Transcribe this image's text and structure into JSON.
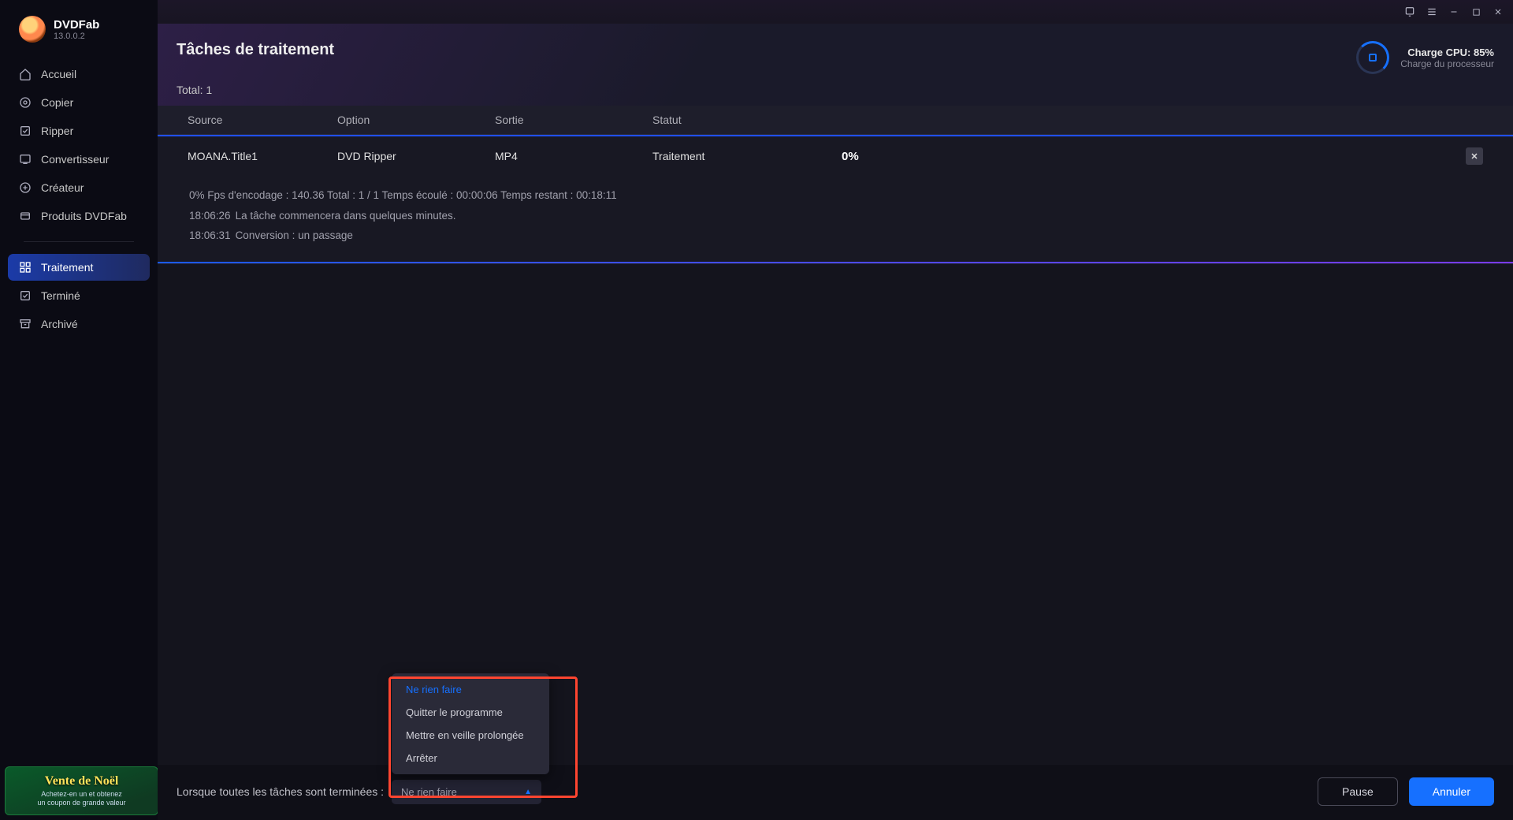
{
  "brand": {
    "name": "DVDFab",
    "version": "13.0.0.2"
  },
  "sidebar": {
    "items": [
      {
        "label": "Accueil"
      },
      {
        "label": "Copier"
      },
      {
        "label": "Ripper"
      },
      {
        "label": "Convertisseur"
      },
      {
        "label": "Créateur"
      },
      {
        "label": "Produits DVDFab"
      }
    ],
    "items2": [
      {
        "label": "Traitement"
      },
      {
        "label": "Terminé"
      },
      {
        "label": "Archivé"
      }
    ]
  },
  "promo": {
    "title": "Vente de Noël",
    "line1": "Achetez-en un et obtenez",
    "line2": "un coupon de grande valeur"
  },
  "page": {
    "title": "Tâches de traitement",
    "total_label": "Total: 1",
    "cpu_label": "Charge CPU: 85%",
    "cpu_sub": "Charge du processeur"
  },
  "columns": {
    "source": "Source",
    "option": "Option",
    "output": "Sortie",
    "status": "Statut"
  },
  "task": {
    "source": "MOANA.Title1",
    "option": "DVD Ripper",
    "output": "MP4",
    "status": "Traitement",
    "percent": "0%",
    "stats": "0%  Fps d'encodage : 140.36   Total : 1 / 1   Temps écoulé : 00:00:06   Temps restant : 00:18:11",
    "log1_time": "18:06:26",
    "log1_msg": "La tâche commencera dans quelques minutes.",
    "log2_time": "18:06:31",
    "log2_msg": "Conversion : un passage"
  },
  "footer": {
    "label": "Lorsque toutes les tâches sont terminées :",
    "selected": "Ne rien faire",
    "options": [
      "Ne rien faire",
      "Quitter le programme",
      "Mettre en veille prolongée",
      "Arrêter"
    ],
    "pause": "Pause",
    "cancel": "Annuler"
  }
}
